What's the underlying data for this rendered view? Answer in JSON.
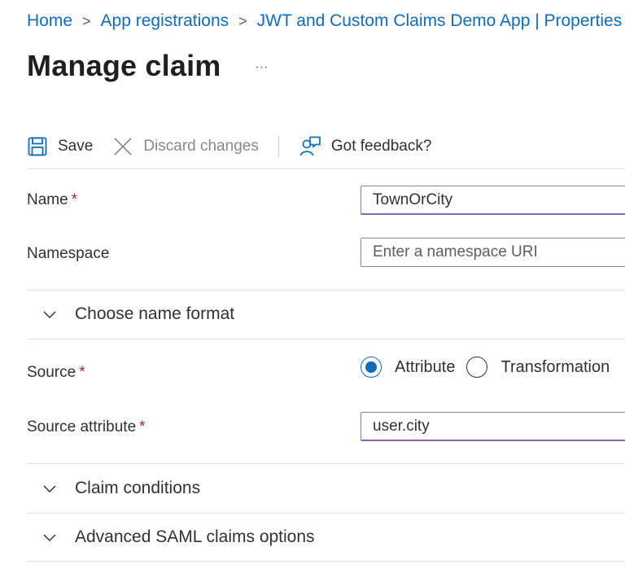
{
  "breadcrumb": {
    "items": [
      "Home",
      "App registrations",
      "JWT and Custom Claims Demo App | Properties"
    ],
    "separator": ">"
  },
  "header": {
    "title": "Manage claim",
    "more": "···"
  },
  "toolbar": {
    "save_label": "Save",
    "discard_label": "Discard changes",
    "feedback_label": "Got feedback?"
  },
  "form": {
    "required_marker": "*",
    "name": {
      "label": "Name",
      "value": "TownOrCity"
    },
    "namespace": {
      "label": "Namespace",
      "placeholder": "Enter a namespace URI",
      "value": ""
    },
    "name_format": {
      "label": "Choose name format"
    },
    "source": {
      "label": "Source",
      "options": [
        "Attribute",
        "Transformation"
      ],
      "selected": "Attribute"
    },
    "source_attribute": {
      "label": "Source attribute",
      "value": "user.city"
    },
    "claim_conditions": {
      "label": "Claim conditions"
    },
    "advanced": {
      "label": "Advanced SAML claims options"
    }
  },
  "colors": {
    "link": "#0f6cbd",
    "required": "#a4262c",
    "input_focus": "#8764b8",
    "radio_selected": "#0f6cbd"
  },
  "icons": {
    "save": "save-icon",
    "discard": "close-icon",
    "feedback": "feedback-icon",
    "chevron": "chevron-down-icon"
  }
}
